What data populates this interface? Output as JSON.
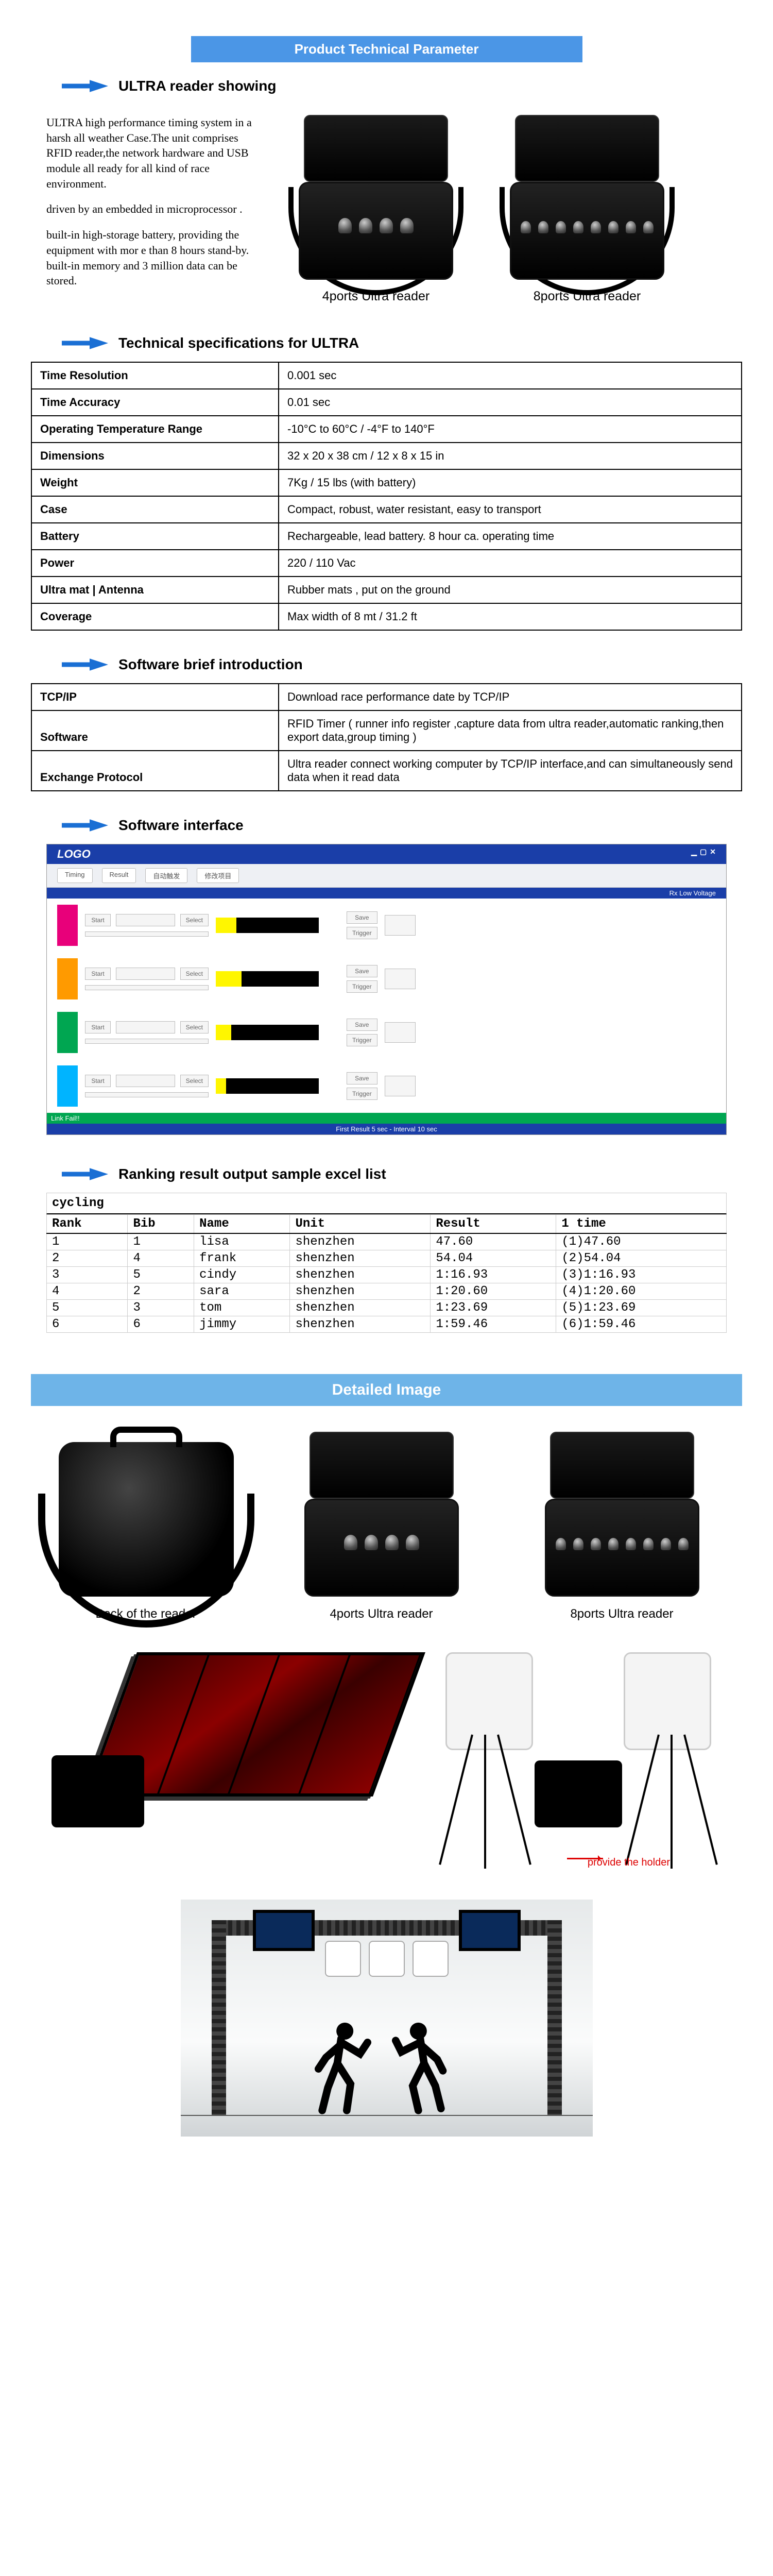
{
  "banners": {
    "tech_param": "Product Technical Parameter",
    "detailed_image": "Detailed Image"
  },
  "headings": {
    "ultra_reader_showing": "ULTRA reader showing",
    "tech_specs": "Technical specifications for ULTRA",
    "software_brief": "Software brief introduction",
    "software_interface": "Software interface",
    "ranking_result": "Ranking result output sample excel list"
  },
  "intro": {
    "p1": "ULTRA high performance timing system in a harsh all weather Case.The unit comprises RFID reader,the network hardware and USB module all ready for all kind of race environment.",
    "p2": "driven by an embedded in microprocessor .",
    "p3": "built-in high-storage battery, providing the equipment with mor e than 8 hours stand-by. built-in memory and 3 million data can be stored.",
    "caption_4p": "4ports Ultra reader",
    "caption_8p": "8ports Ultra reader"
  },
  "specs": [
    {
      "k": "Time Resolution",
      "v": "0.001 sec"
    },
    {
      "k": "Time Accuracy",
      "v": "0.01 sec"
    },
    {
      "k": "Operating Temperature Range",
      "v": "-10°C to 60°C / -4°F to 140°F"
    },
    {
      "k": "Dimensions",
      "v": "32 x 20 x 38 cm / 12 x 8 x 15 in"
    },
    {
      "k": "Weight",
      "v": "7Kg / 15 lbs (with battery)"
    },
    {
      "k": "Case",
      "v": "Compact, robust, water resistant, easy to transport"
    },
    {
      "k": "Battery",
      "v": "Rechargeable, lead battery. 8 hour ca. operating time"
    },
    {
      "k": "Power",
      "v": "220 / 110 Vac"
    },
    {
      "k": "Ultra mat | Antenna",
      "v": "Rubber mats , put on the ground"
    },
    {
      "k": "Coverage",
      "v": "Max width of 8 mt / 31.2 ft"
    }
  ],
  "software_table": [
    {
      "k": "TCP/IP",
      "v": "Download race performance date by TCP/IP"
    },
    {
      "k": "Software",
      "v": " RFID Timer ( runner info register ,capture data from ultra reader,automatic ranking,then export data,group timing )"
    },
    {
      "k": "Exchange Protocol",
      "v": "Ultra reader connect working computer by TCP/IP interface,and can simultaneously send data when it read data"
    }
  ],
  "app": {
    "logo": "LOGO",
    "toolbar": [
      "Timing",
      "Result",
      "自动触发",
      "修改项目"
    ],
    "status_right": [
      "Rx",
      "Low Voltage"
    ],
    "row_buttons": {
      "start": "Start",
      "select": "Select",
      "save": "Save",
      "trigger": "Trigger"
    },
    "footer_left": "Link Fail!!",
    "footer_center": "First Result 5 sec - Interval 10 sec",
    "rows": [
      {
        "color": "#e8007a",
        "bar_color": "#fff600",
        "bar_pct": 20
      },
      {
        "color": "#ff9a00",
        "bar_color": "#fff600",
        "bar_pct": 25
      },
      {
        "color": "#00a651",
        "bar_color": "#fff600",
        "bar_pct": 15
      },
      {
        "color": "#00b4ff",
        "bar_color": "#fff600",
        "bar_pct": 10
      }
    ]
  },
  "excel": {
    "title": "cycling",
    "headers": [
      "Rank",
      "Bib",
      "Name",
      "Unit",
      "Result",
      "1 time"
    ],
    "rows": [
      [
        "1",
        "1",
        "lisa",
        "shenzhen",
        "47.60",
        "(1)47.60"
      ],
      [
        "2",
        "4",
        "frank",
        "shenzhen",
        "54.04",
        "(2)54.04"
      ],
      [
        "3",
        "5",
        "cindy",
        "shenzhen",
        "1:16.93",
        "(3)1:16.93"
      ],
      [
        "4",
        "2",
        "sara",
        "shenzhen",
        "1:20.60",
        "(4)1:20.60"
      ],
      [
        "5",
        "3",
        "tom",
        "shenzhen",
        "1:23.69",
        "(5)1:23.69"
      ],
      [
        "6",
        "6",
        "jimmy",
        "shenzhen",
        "1:59.46",
        "(6)1:59.46"
      ]
    ]
  },
  "detail_captions": {
    "back": "Back of the reader",
    "p4": "4ports Ultra reader",
    "p8": "8ports Ultra reader"
  },
  "overlay": {
    "provide": "provide the holder"
  }
}
